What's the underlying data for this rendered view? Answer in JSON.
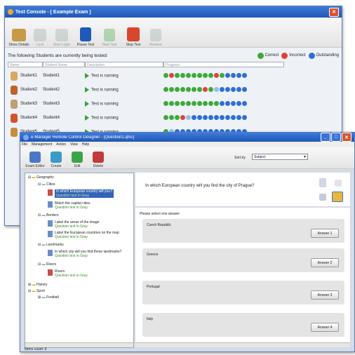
{
  "win1": {
    "title": "Test Console - [ Example Exam ]",
    "toolbar": [
      {
        "label": "Show Details",
        "color": "#c79a4a",
        "dim": false
      },
      {
        "label": "Lock",
        "color": "#9aa",
        "dim": true
      },
      {
        "label": "Start Login",
        "color": "#9aa",
        "dim": true
      },
      {
        "label": "Pause Test",
        "color": "#1f5ab8",
        "dim": false
      },
      {
        "label": "Start Test",
        "color": "#3aa545",
        "dim": true
      },
      {
        "label": "Stop Test",
        "color": "#d8462e",
        "dim": false
      },
      {
        "label": "Restore",
        "color": "#9aa",
        "dim": true
      }
    ],
    "heading": "The following Students are currently being tested:",
    "legend": [
      {
        "label": "Correct",
        "color": "#3bab37"
      },
      {
        "label": "Incorrect",
        "color": "#e0413a"
      },
      {
        "label": "Outstanding",
        "color": "#2f6fd3"
      }
    ],
    "columns": [
      "Name",
      "Student Name",
      "Description",
      "Progress"
    ],
    "students": [
      {
        "name": "Student1",
        "student_name": "Student1",
        "status": "Test is running",
        "avatar": "#d8a85e",
        "progress": [
          "g",
          "r",
          "g",
          "g",
          "g",
          "g",
          "g",
          "g",
          "g",
          "r",
          "g",
          "b",
          "b",
          "b",
          "b"
        ]
      },
      {
        "name": "Student2",
        "student_name": "Student2",
        "status": "Test is running",
        "avatar": "#c0612a",
        "progress": [
          "g",
          "g",
          "g",
          "g",
          "g",
          "g",
          "g",
          "r",
          "g",
          "lb",
          "b",
          "b",
          "b",
          "b",
          "b"
        ]
      },
      {
        "name": "Student3",
        "student_name": "Student3",
        "status": "Test is running",
        "avatar": "#bfa070",
        "progress": [
          "g",
          "g",
          "g",
          "g",
          "g",
          "g",
          "g",
          "g",
          "g",
          "g",
          "b",
          "b",
          "b",
          "b",
          "b"
        ]
      },
      {
        "name": "Student4",
        "student_name": "Student4",
        "status": "Test is running",
        "avatar": "#d2542b",
        "progress": [
          "g",
          "g",
          "g",
          "r",
          "lb",
          "b",
          "b",
          "b",
          "b",
          "b",
          "b",
          "b",
          "b",
          "b",
          "b"
        ]
      },
      {
        "name": "Student5",
        "student_name": "Student5",
        "status": "Test is running",
        "avatar": "#c98b3f",
        "progress": [
          "g",
          "lb",
          "b",
          "b",
          "b",
          "b",
          "b",
          "b",
          "b",
          "b",
          "b",
          "b",
          "b",
          "b",
          "b"
        ]
      }
    ]
  },
  "win2": {
    "title": "e-Manager Remote Control Designer - [Question1.qfsc]",
    "menu": [
      "File",
      "Management",
      "Action",
      "View",
      "Help"
    ],
    "toolbar": [
      {
        "label": "Exam Editor",
        "color": "#4a78c9"
      },
      {
        "label": "Create",
        "color": "#3a9acb"
      },
      {
        "label": "Edit",
        "color": "#3aa545"
      },
      {
        "label": "Delete",
        "color": "#c23a3a"
      }
    ],
    "sort_label": "Sort by",
    "sort_value": "Subject",
    "question": "In which European country will you find the city of Prague?",
    "instructions": "Please select one answer.",
    "answers": [
      {
        "text": "Czech Republic",
        "button": "Answer 1"
      },
      {
        "text": "Greece",
        "button": "Answer 2"
      },
      {
        "text": "Portugal",
        "button": "Answer 3"
      },
      {
        "text": "Italy",
        "button": "Answer 4"
      }
    ],
    "tree": [
      {
        "label": "Geography",
        "sub": ""
      },
      {
        "label": "Cities",
        "sub": ""
      },
      {
        "label": "In which European country will you find the city of Prague?",
        "sub": "Question text in Gray"
      },
      {
        "label": "Match the capital cities",
        "sub": "Question text in Gray"
      },
      {
        "label": "Borders",
        "sub": ""
      },
      {
        "label": "Label the areas of the image",
        "sub": "Question text in Gray"
      },
      {
        "label": "Label the European countries on the map",
        "sub": "Question text in Gray"
      },
      {
        "label": "Landmarks",
        "sub": ""
      },
      {
        "label": "In which city will you find these landmarks?",
        "sub": "Question text in Gray"
      },
      {
        "label": "Rivers",
        "sub": ""
      },
      {
        "label": "Rivers",
        "sub": "Question text in Gray"
      },
      {
        "label": "History",
        "sub": ""
      },
      {
        "label": "Sport",
        "sub": ""
      },
      {
        "label": "Football",
        "sub": ""
      }
    ],
    "status": "Items count: 9"
  }
}
